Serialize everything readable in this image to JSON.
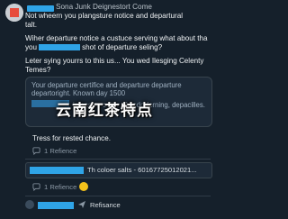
{
  "tweet": {
    "author": "Sona Junk Deignestort Come",
    "lines": [
      "Not wheern you plangsture notice and departural",
      "talt.",
      "Wiher departure notice a custuce serving what about tha",
      "you",
      "shot of departure seling?",
      "Leter sying yourrs to this us... You wed Ilesging Celenty",
      "Temes?"
    ]
  },
  "quote": {
    "line1": "Your departure certifice and departure departure",
    "line2": "departoright. Known day 1500",
    "line3": "intensive colier of codorforning, depacilles."
  },
  "watermark": "云南红茶特点",
  "reply": {
    "text": "Tress for rested chance.",
    "count1": "1 Refience",
    "card_text": "Th coloer salts - 60167725012021...",
    "count2": "1 Refience",
    "bottom_label": "Refisance"
  },
  "colors": {
    "background": "#15202b",
    "redaction": "#2fa4e7"
  }
}
